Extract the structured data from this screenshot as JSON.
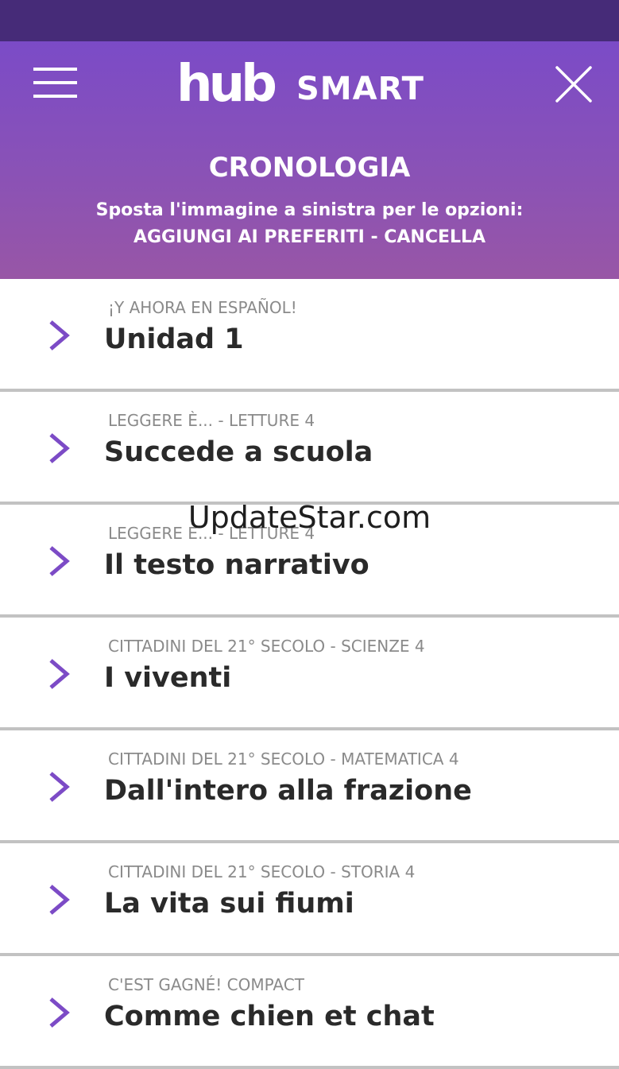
{
  "header": {
    "logo_hub": "hub",
    "logo_smart": "SMART",
    "title": "CRONOLOGIA",
    "instruction_line1": "Sposta l'immagine a sinistra per le opzioni:",
    "instruction_line2": "AGGIUNGI AI PREFERITI - CANCELLA",
    "menu_icon": "hamburger-menu-icon",
    "close_icon": "close-icon",
    "gradient_top": "#7b4bc7",
    "gradient_bottom": "#9856a6"
  },
  "status_bar_color": "#462b78",
  "accent_color": "#7c4bc6",
  "history": {
    "items": [
      {
        "subtitle": "¡Y AHORA EN ESPAÑOL!",
        "title": "Unidad 1"
      },
      {
        "subtitle": "LEGGERE È... - LETTURE 4",
        "title": "Succede a scuola"
      },
      {
        "subtitle": "LEGGERE È... - LETTURE 4",
        "title": "Il testo narrativo"
      },
      {
        "subtitle": "CITTADINI DEL 21° SECOLO - SCIENZE 4",
        "title": "I viventi"
      },
      {
        "subtitle": "CITTADINI DEL 21° SECOLO - MATEMATICA 4",
        "title": "Dall'intero alla frazione"
      },
      {
        "subtitle": "CITTADINI DEL 21° SECOLO - STORIA 4",
        "title": "La vita sui fiumi"
      },
      {
        "subtitle": "C'EST GAGNÉ! COMPACT",
        "title": "Comme chien et chat"
      }
    ]
  },
  "watermark": "UpdateStar.com"
}
